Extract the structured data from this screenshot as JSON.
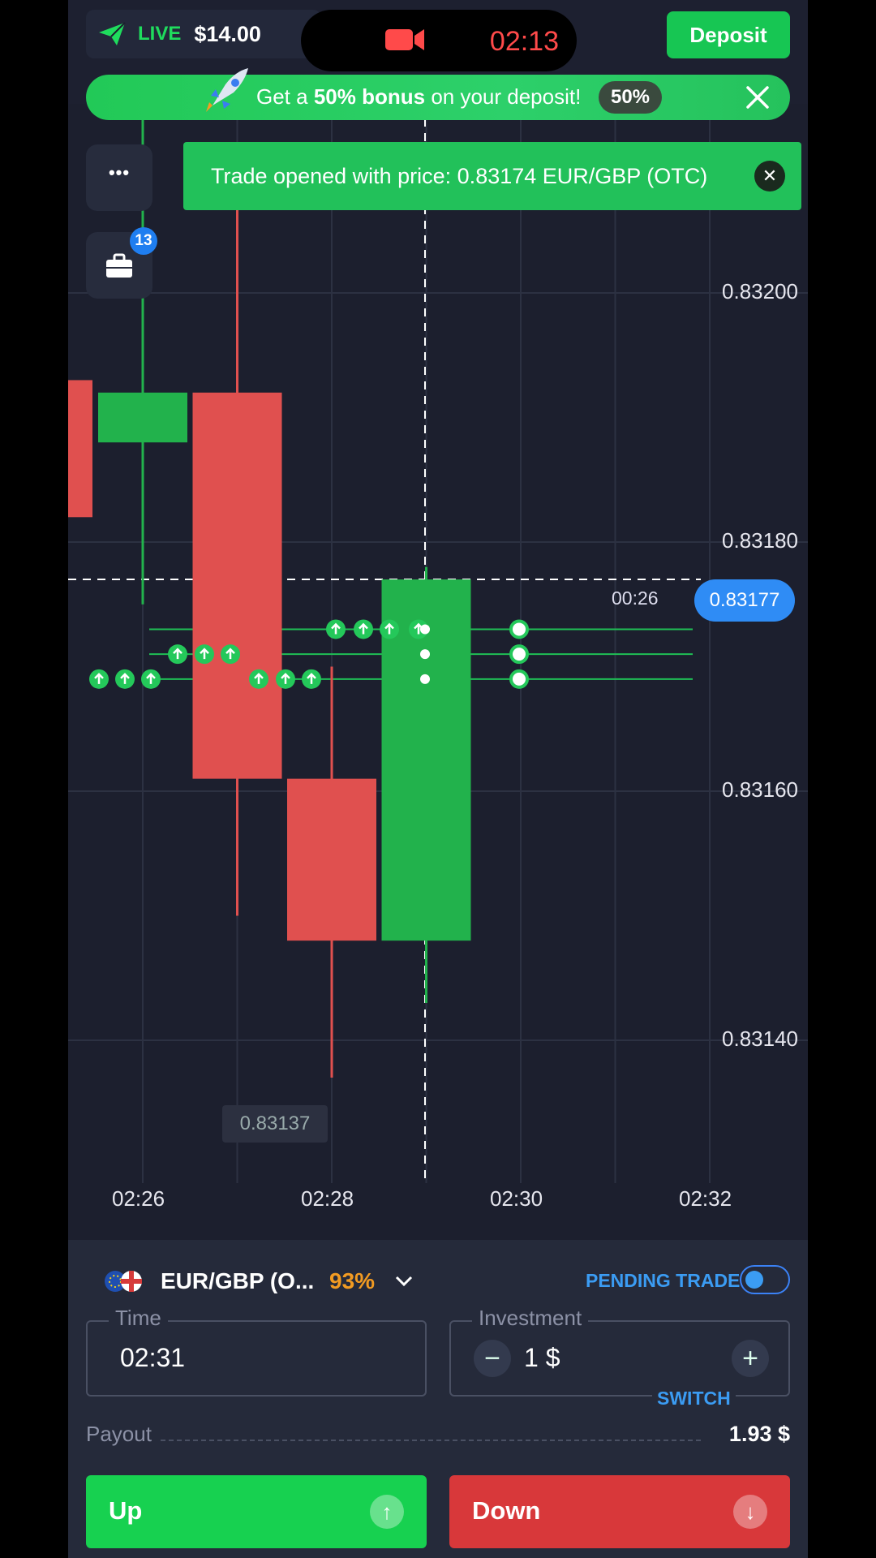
{
  "topbar": {
    "account_mode": "LIVE",
    "balance": "$14.00",
    "recording_time": "02:13",
    "deposit_label": "Deposit"
  },
  "promo": {
    "text_prefix": "Get a ",
    "text_bold_pct": "50%",
    "text_bold_word": " bonus",
    "text_suffix": " on your deposit!",
    "badge": "50%"
  },
  "toast": {
    "message": "Trade opened with price: 0.83174 EUR/GBP (OTC)",
    "close_glyph": "✕"
  },
  "sidebar": {
    "menu_glyph": "•••",
    "trades_count": "13"
  },
  "chart": {
    "price_labels": [
      "0.83200",
      "0.83180",
      "0.83160",
      "0.83140"
    ],
    "time_labels": [
      "02:26",
      "02:28",
      "02:30",
      "02:32"
    ],
    "current_price": "0.83177",
    "countdown": "00:26",
    "low_price": "0.83137",
    "colors": {
      "up": "#22b24c",
      "down": "#e0504f",
      "background": "#1c1f2e",
      "accent": "#2f8cf5"
    }
  },
  "chart_data": {
    "type": "candlestick",
    "x": [
      "02:26",
      "02:27",
      "02:28",
      "02:29"
    ],
    "open": [
      0.83188,
      0.83192,
      0.83161,
      0.83148
    ],
    "high": [
      0.83218,
      0.8321,
      0.8317,
      0.83178
    ],
    "low": [
      0.83175,
      0.8315,
      0.83137,
      0.83143
    ],
    "close": [
      0.83192,
      0.83161,
      0.83148,
      0.83177
    ],
    "ylim": [
      0.8313,
      0.83225
    ],
    "y_ticks": [
      0.8314,
      0.8316,
      0.8318,
      0.832
    ],
    "x_ticks": [
      "02:26",
      "02:28",
      "02:30",
      "02:32"
    ]
  },
  "asset": {
    "name": "EUR/GBP (O...",
    "payout_pct": "93%",
    "pending_label": "PENDING TRADE"
  },
  "time_field": {
    "label": "Time",
    "value": "02:31"
  },
  "investment_field": {
    "label": "Investment",
    "value": "1 $",
    "minus": "−",
    "plus": "+",
    "switch_label": "SWITCH"
  },
  "payout": {
    "label": "Payout",
    "value": "1.93 $"
  },
  "actions": {
    "up_label": "Up",
    "up_arrow": "↑",
    "down_label": "Down",
    "down_arrow": "↓"
  }
}
